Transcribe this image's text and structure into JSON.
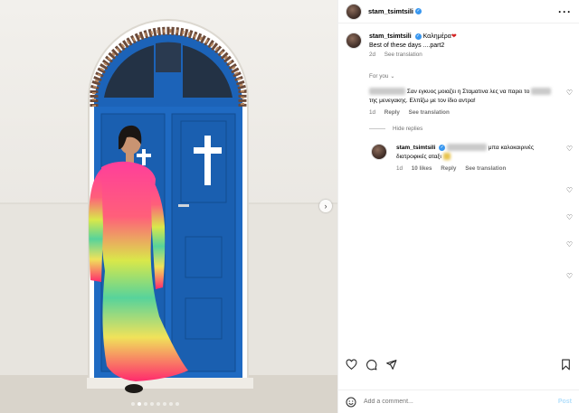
{
  "post": {
    "username": "stam_tsimtsili",
    "more_icon": "more-horizontal-icon"
  },
  "caption": {
    "username": "stam_tsimtsili",
    "greeting": "Καλημέρα",
    "heart": "❤",
    "text": "Best of these days ....part2",
    "age": "2d",
    "see_translation": "See translation"
  },
  "section_label": "For you",
  "comment1": {
    "text": "Σαν εγκυος μοιαζει η Σταματινα λες να παρει το",
    "text2": "της μενεγακης. Ελπίζω με τον ίδιο αντρα!",
    "age": "1d",
    "reply": "Reply",
    "see_translation": "See translation"
  },
  "hide_replies": "Hide replies",
  "reply1": {
    "username": "stam_tsimtsili",
    "text": "μπα καλοκαιρινές",
    "text2": "διατροφικές αταξι",
    "age": "1d",
    "likes": "10 likes",
    "reply": "Reply",
    "see_translation": "See translation"
  },
  "footer": {
    "placeholder": "Add a comment...",
    "post_label": "Post"
  },
  "carousel": {
    "dots_total": 8,
    "active_index": 1
  }
}
